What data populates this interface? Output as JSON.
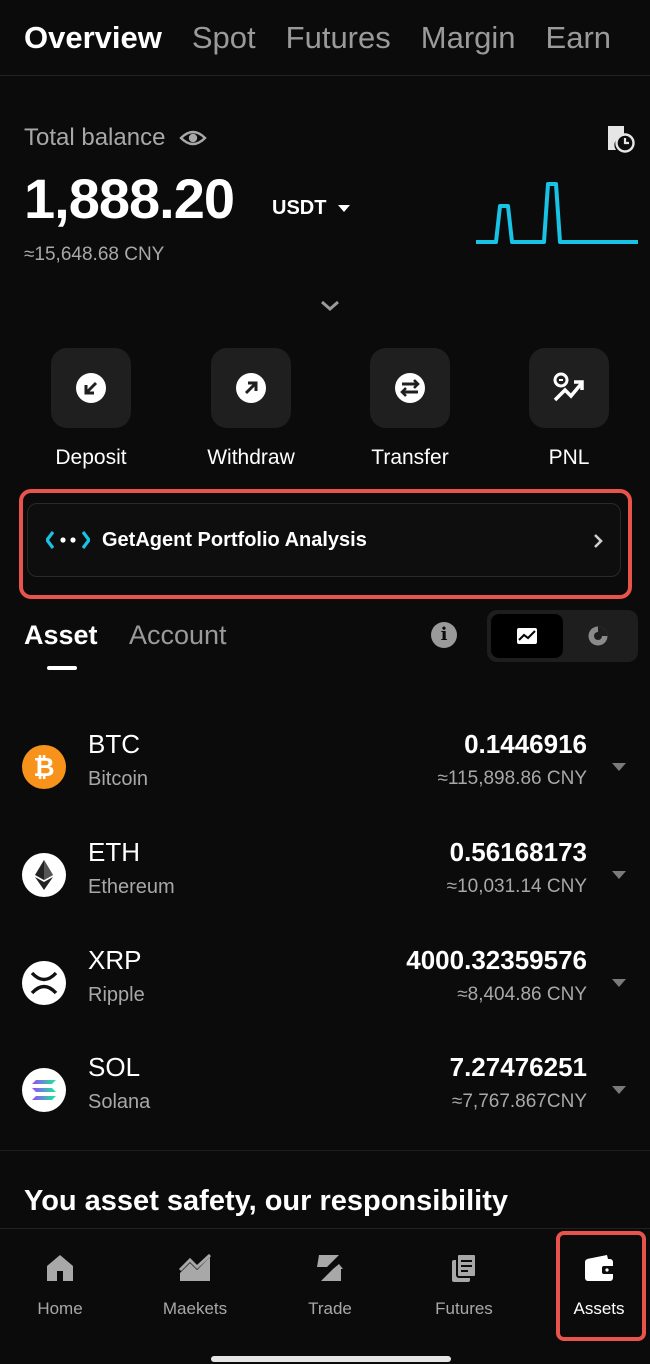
{
  "top_tabs": [
    {
      "label": "Overview",
      "active": true
    },
    {
      "label": "Spot",
      "active": false
    },
    {
      "label": "Futures",
      "active": false
    },
    {
      "label": "Margin",
      "active": false
    },
    {
      "label": "Earn",
      "active": false
    }
  ],
  "balance": {
    "label": "Total balance",
    "amount": "1,888.20",
    "currency": "USDT",
    "cny": "≈15,648.68 CNY"
  },
  "actions": [
    {
      "label": "Deposit",
      "icon": "deposit-icon"
    },
    {
      "label": "Withdraw",
      "icon": "withdraw-icon"
    },
    {
      "label": "Transfer",
      "icon": "transfer-icon"
    },
    {
      "label": "PNL",
      "icon": "pnl-icon"
    }
  ],
  "agent_banner": {
    "title": "GetAgent Portfolio Analysis"
  },
  "section_tabs": {
    "asset": "Asset",
    "account": "Account"
  },
  "info_glyph": "i",
  "assets": [
    {
      "symbol": "BTC",
      "name": "Bitcoin",
      "amount": "0.1446916",
      "cny": "≈115,898.86 CNY",
      "icon_color": "#f7931a"
    },
    {
      "symbol": "ETH",
      "name": "Ethereum",
      "amount": "0.56168173",
      "cny": "≈10,031.14 CNY",
      "icon_color": "#ffffff"
    },
    {
      "symbol": "XRP",
      "name": "Ripple",
      "amount": "4000.32359576",
      "cny": "≈8,404.86 CNY",
      "icon_color": "#ffffff"
    },
    {
      "symbol": "SOL",
      "name": "Solana",
      "amount": "7.27476251",
      "cny": "≈7,767.867CNY",
      "icon_color": "#ffffff"
    }
  ],
  "safety_text": "You asset safety, our responsibility",
  "bottom_nav": [
    {
      "label": "Home",
      "icon": "home-icon",
      "active": false
    },
    {
      "label": "Maekets",
      "icon": "markets-icon",
      "active": false
    },
    {
      "label": "Trade",
      "icon": "trade-icon",
      "active": false
    },
    {
      "label": "Futures",
      "icon": "futures-icon",
      "active": false
    },
    {
      "label": "Assets",
      "icon": "wallet-icon",
      "active": true
    }
  ],
  "colors": {
    "accent": "#19c3e6",
    "highlight": "#e8534c",
    "background": "#0b0b0b"
  }
}
